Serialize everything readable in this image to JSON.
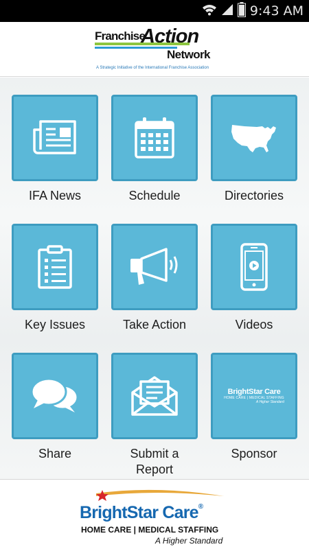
{
  "status_bar": {
    "time": "9:43 AM",
    "icons": [
      "wifi-icon",
      "signal-icon",
      "battery-icon"
    ]
  },
  "header": {
    "logo": {
      "word1": "Franchise",
      "word2": "Action",
      "word3": "Network",
      "tagline": "A Strategic Initiative of the International Franchise Association"
    }
  },
  "tiles": [
    {
      "label": "IFA News",
      "icon": "newspaper-icon"
    },
    {
      "label": "Schedule",
      "icon": "calendar-icon"
    },
    {
      "label": "Directories",
      "icon": "us-map-icon"
    },
    {
      "label": "Key Issues",
      "icon": "clipboard-icon"
    },
    {
      "label": "Take Action",
      "icon": "megaphone-icon"
    },
    {
      "label": "Videos",
      "icon": "phone-video-icon"
    },
    {
      "label": "Share",
      "icon": "chat-bubbles-icon"
    },
    {
      "label": "Submit a Report",
      "icon": "envelope-icon"
    },
    {
      "label": "Sponsor",
      "icon": "sponsor-logo"
    }
  ],
  "sponsor_tile_logo": {
    "name": "BrightStar Care",
    "sub": "HOME CARE | MEDICAL STAFFING",
    "tag": "A Higher Standard"
  },
  "footer": {
    "name": "BrightStar Care",
    "registered": "®",
    "sub": "HOME CARE | MEDICAL STAFFING",
    "tag": "A Higher Standard"
  },
  "colors": {
    "tile_fill": "#5bb8d8",
    "tile_border": "#3e9cc0",
    "brand_blue": "#1668b0",
    "logo_green": "#8dc63f"
  }
}
